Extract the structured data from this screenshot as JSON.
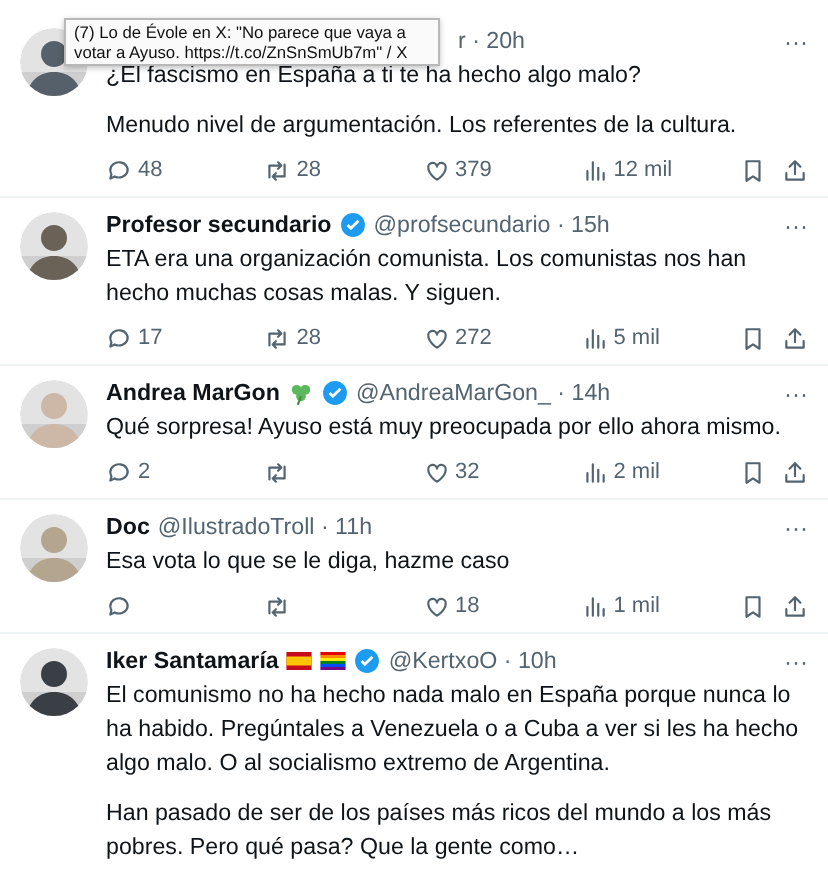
{
  "tooltip": {
    "text": "(7) Lo de Évole en X: \"No parece que vaya a votar a Ayuso. https://t.co/ZnSnSmUb7m\" / X"
  },
  "tweets": [
    {
      "verified": false,
      "meta": "r · 20h",
      "more": "···",
      "paragraphs": [
        "¿El fascismo en España a ti te ha hecho algo malo?",
        "Menudo nivel de argumentación. Los referentes de la cultura."
      ],
      "replies": "48",
      "reposts": "28",
      "likes": "379",
      "views": "12 mil"
    },
    {
      "name": "Profesor secundario",
      "verified": true,
      "meta": "@profsecundario · 15h",
      "more": "···",
      "paragraphs": [
        "ETA era una organización comunista. Los comunistas nos han hecho muchas cosas malas. Y siguen."
      ],
      "replies": "17",
      "reposts": "28",
      "likes": "272",
      "views": "5 mil"
    },
    {
      "name": "Andrea MarGon",
      "verified": true,
      "emoji": [
        {
          "kind": "shamrock"
        }
      ],
      "meta": "@AndreaMarGon_ · 14h",
      "more": "···",
      "paragraphs": [
        "Qué sorpresa! Ayuso está muy preocupada por ello ahora mismo."
      ],
      "replies": "2",
      "likes": "32",
      "views": "2 mil"
    },
    {
      "name": "Doc",
      "verified": false,
      "meta": "@IlustradoTroll · 11h",
      "more": "···",
      "paragraphs": [
        "Esa vota lo que se le diga, hazme caso"
      ],
      "likes": "18",
      "views": "1 mil"
    },
    {
      "name": "Iker Santamaría",
      "verified": true,
      "emoji": [
        {
          "kind": "spain-flag"
        },
        {
          "kind": "rainbow-flag"
        }
      ],
      "meta": "@KertxoO · 10h",
      "more": "···",
      "paragraphs": [
        "El comunismo no ha hecho nada malo en España porque nunca lo ha habido. Pregúntales a Venezuela o a Cuba a ver si les ha hecho algo malo. O al socialismo extremo de Argentina.",
        "Han pasado de ser de los países más ricos del mundo a los más pobres. Pero qué pasa? Que la gente como…"
      ]
    }
  ]
}
